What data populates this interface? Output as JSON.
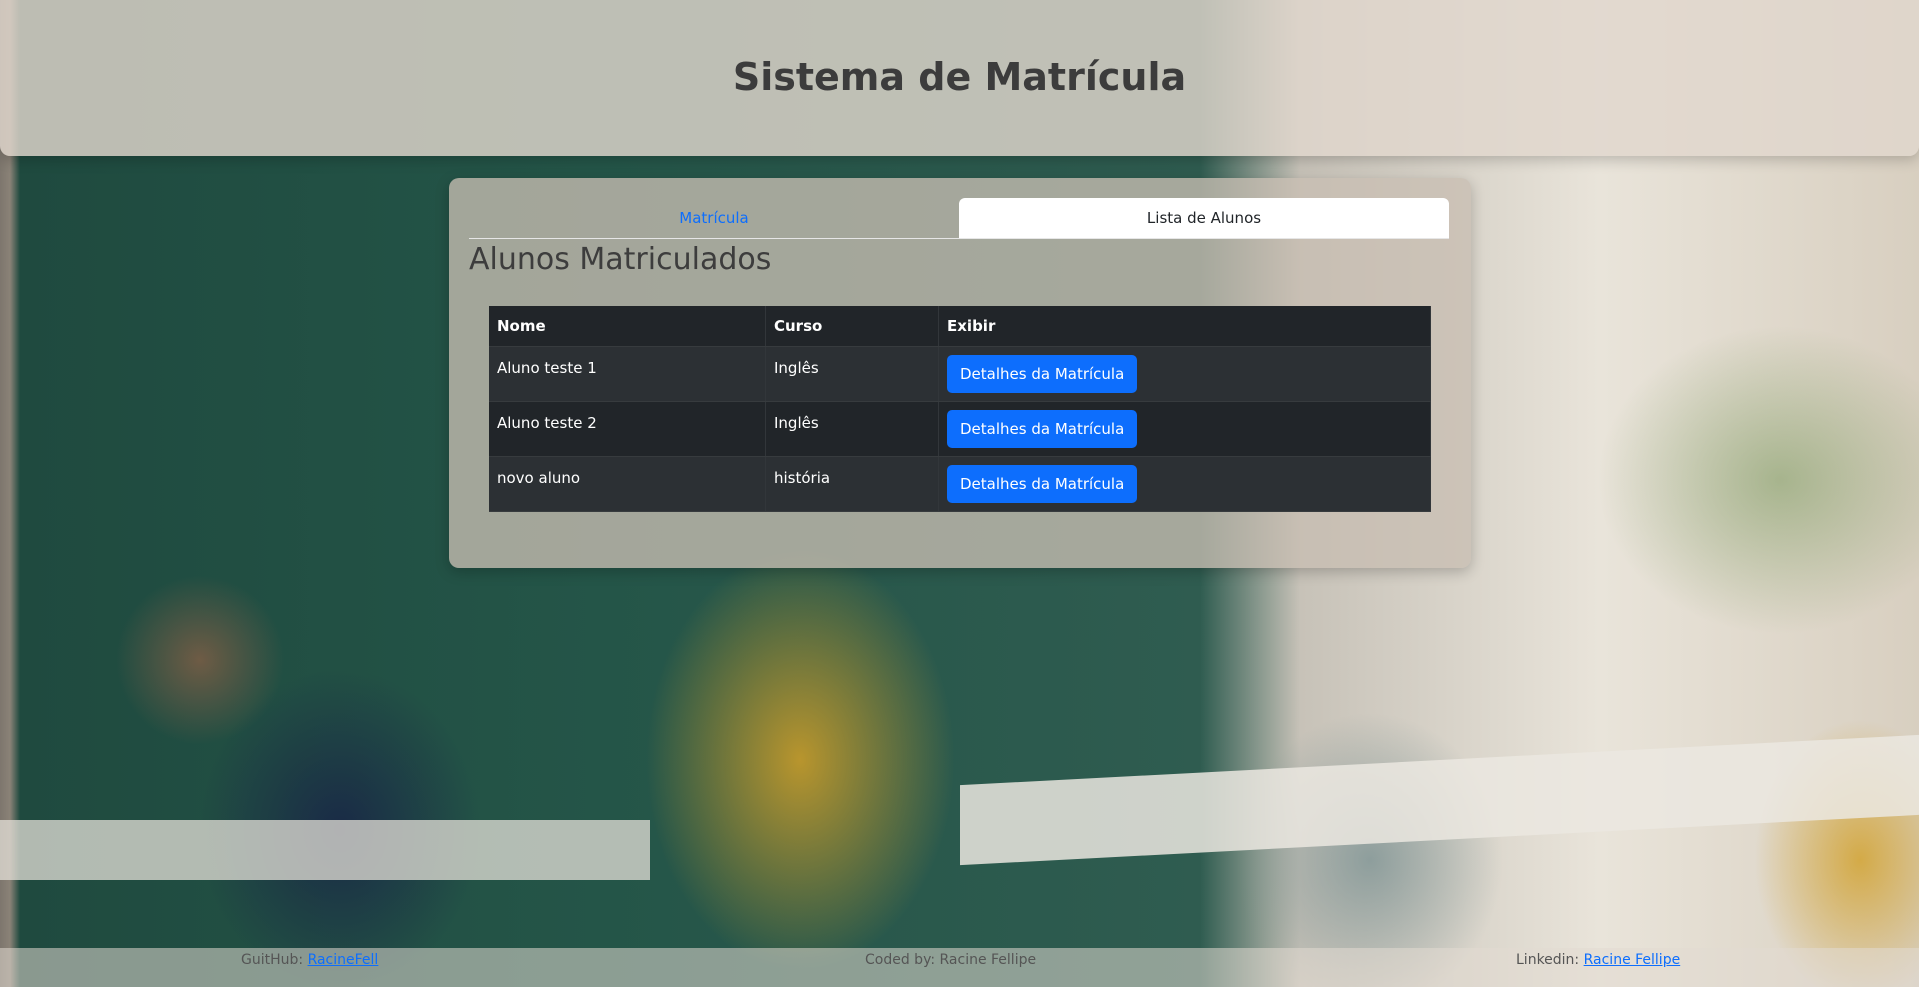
{
  "header": {
    "title": "Sistema de Matrícula"
  },
  "tabs": [
    {
      "label": "Matrícula",
      "active": false
    },
    {
      "label": "Lista de Alunos",
      "active": true
    }
  ],
  "section": {
    "title": "Alunos Matriculados"
  },
  "table": {
    "columns": [
      "Nome",
      "Curso",
      "Exibir"
    ],
    "rows": [
      {
        "nome": "Aluno teste 1",
        "curso": "Inglês",
        "action": "Detalhes da Matrícula"
      },
      {
        "nome": "Aluno teste 2",
        "curso": "Inglês",
        "action": "Detalhes da Matrícula"
      },
      {
        "nome": "novo aluno",
        "curso": "história",
        "action": "Detalhes da Matrícula"
      }
    ]
  },
  "footer": {
    "github_label": "GuitHub:",
    "github_link": "RacineFell",
    "credit": "Coded by: Racine Fellipe",
    "linkedin_label": "Linkedin:",
    "linkedin_link": "Racine Fellipe"
  },
  "colors": {
    "accent": "#0d6efd",
    "table_bg": "#212529",
    "table_stripe": "#2c3034"
  }
}
